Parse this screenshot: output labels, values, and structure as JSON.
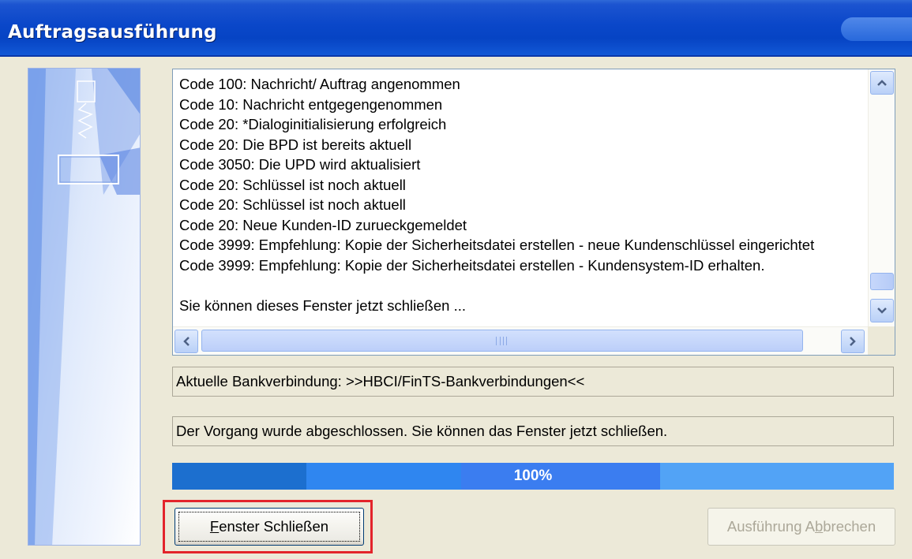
{
  "window": {
    "title": "Auftragsausführung"
  },
  "log": {
    "lines": [
      "Code 100: Nachricht/ Auftrag angenommen",
      "Code 10: Nachricht entgegengenommen",
      "Code 20: *Dialoginitialisierung erfolgreich",
      "Code 20: Die BPD ist bereits aktuell",
      "Code 3050: Die UPD wird aktualisiert",
      "Code 20: Schlüssel ist noch aktuell",
      "Code 20: Schlüssel ist noch aktuell",
      "Code 20: Neue Kunden-ID zurueckgemeldet",
      "Code 3999: Empfehlung: Kopie der Sicherheitsdatei erstellen - neue Kundenschlüssel eingerichtet",
      "Code 3999: Empfehlung: Kopie der Sicherheitsdatei erstellen - Kundensystem-ID erhalten.",
      "",
      "Sie können dieses Fenster jetzt schließen ..."
    ]
  },
  "status": {
    "connection": "Aktuelle Bankverbindung: >>HBCI/FinTS-Bankverbindungen<<",
    "message": "Der Vorgang wurde abgeschlossen. Sie können das Fenster jetzt schließen."
  },
  "progress": {
    "value": 1.0,
    "label": "100%"
  },
  "buttons": {
    "close_label": "Fenster Schließen",
    "close_mnemonic": "F",
    "close_rest": "enster Schließen",
    "abort_label": "Ausführung Abbrechen",
    "abort_before": "Ausführung A",
    "abort_mnemonic": "b",
    "abort_after": "brechen"
  },
  "icons": {
    "scroll_up": "chevron-up-icon",
    "scroll_down": "chevron-down-icon",
    "scroll_left": "chevron-left-icon",
    "scroll_right": "chevron-right-icon"
  },
  "colors": {
    "title_bar": "#0a47c9",
    "progress_fill": "#52a3f6",
    "highlight": "#e3242b"
  }
}
